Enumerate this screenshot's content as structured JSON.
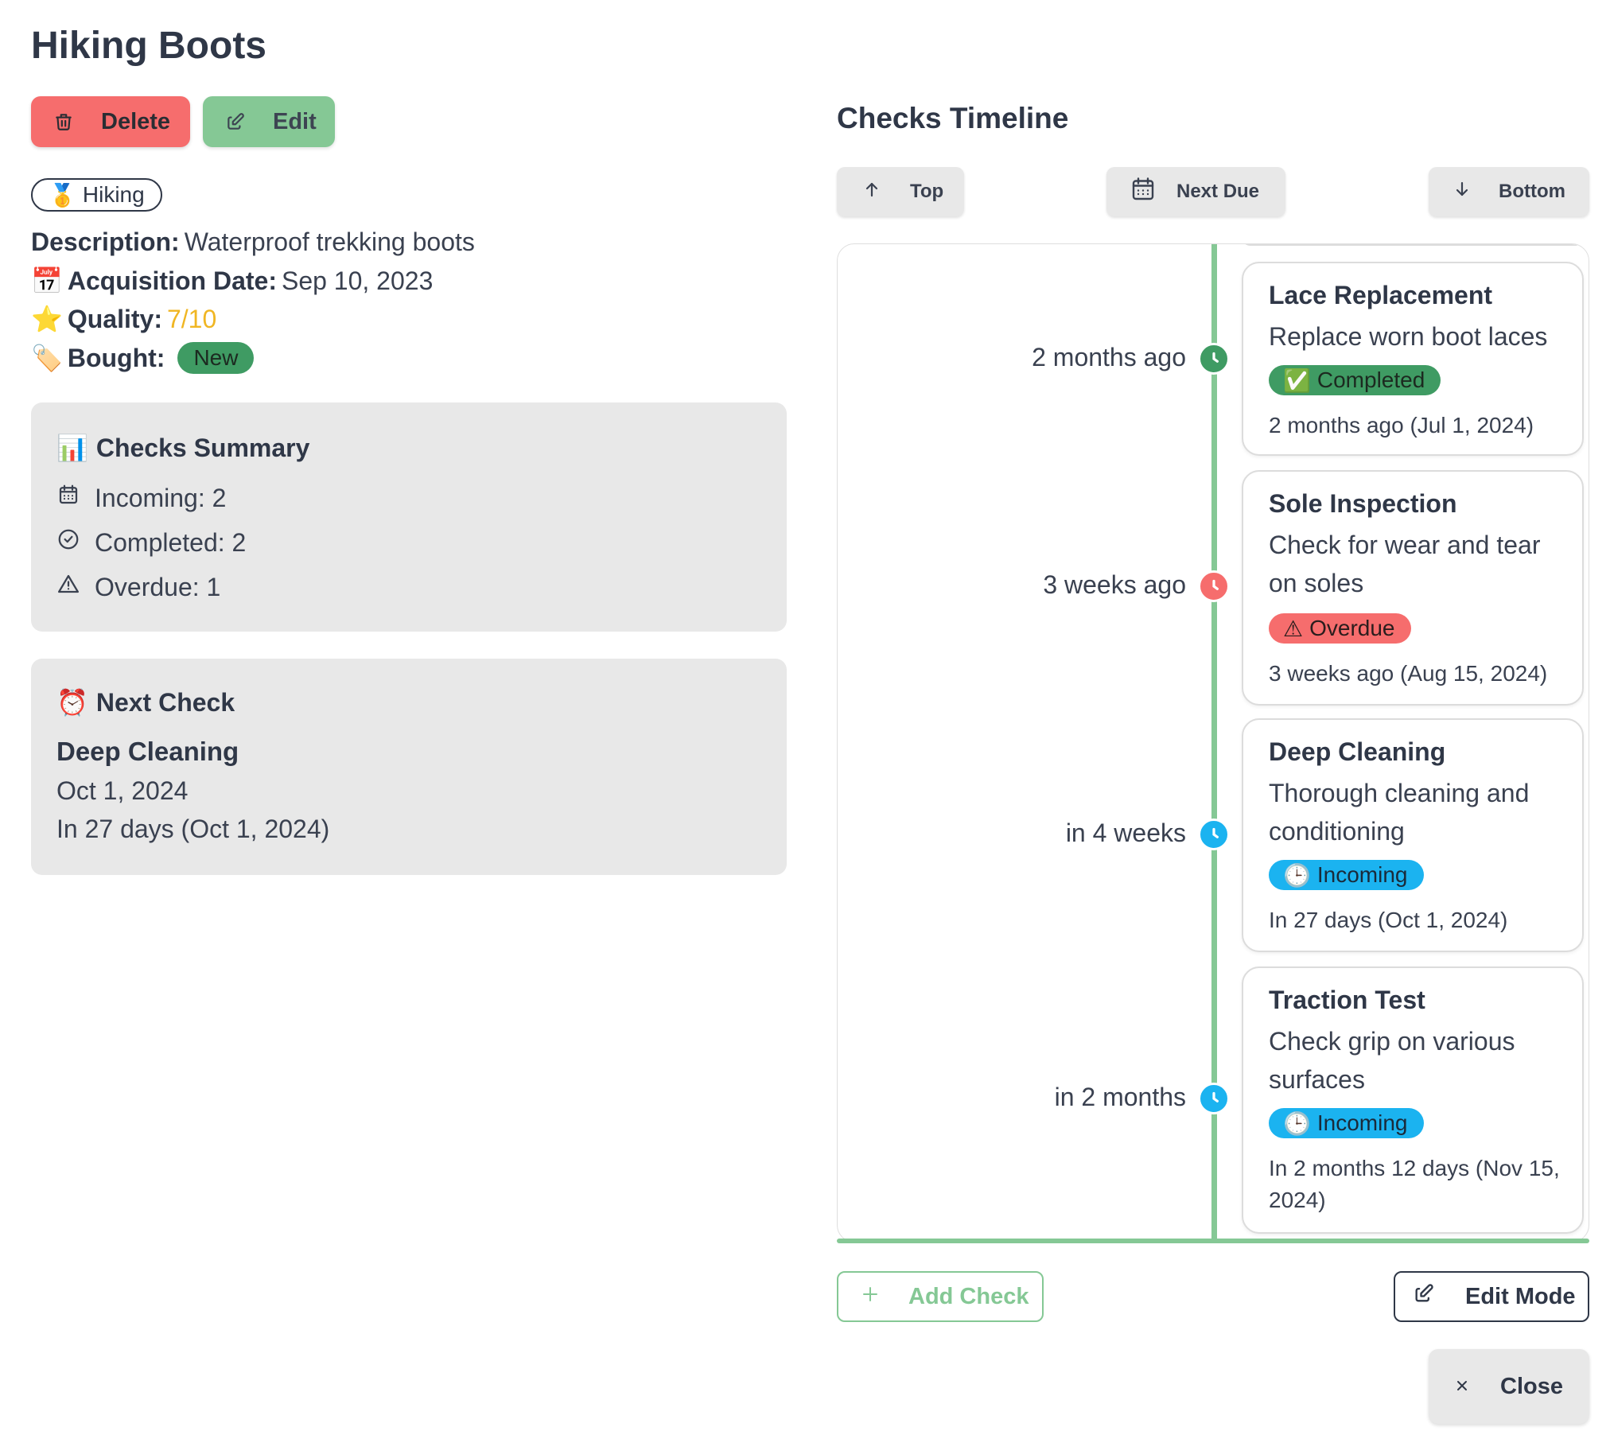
{
  "header": {
    "title": "Hiking Boots"
  },
  "actions": {
    "delete_label": "Delete",
    "edit_label": "Edit"
  },
  "category_tag": {
    "emoji": "🥇",
    "label": "Hiking"
  },
  "details": {
    "description_label": "Description:",
    "description_value": "Waterproof trekking boots",
    "acquisition_emoji": "📅",
    "acquisition_label": "Acquisition Date:",
    "acquisition_value": "Sep 10, 2023",
    "quality_emoji": "⭐",
    "quality_label": "Quality:",
    "quality_value": "7/10",
    "bought_emoji": "🏷️",
    "bought_label": "Bought:",
    "bought_value": "New"
  },
  "summary": {
    "emoji": "📊",
    "title": "Checks Summary",
    "incoming": "Incoming: 2",
    "completed": "Completed: 2",
    "overdue": "Overdue: 1"
  },
  "next_check": {
    "emoji": "⏰",
    "title": "Next Check",
    "name": "Deep Cleaning",
    "date": "Oct 1, 2024",
    "relative": "In 27 days (Oct 1, 2024)"
  },
  "timeline": {
    "title": "Checks Timeline",
    "nav": {
      "top": "Top",
      "next_due": "Next Due",
      "bottom": "Bottom"
    },
    "items": [
      {
        "when": "2 months ago",
        "title": "Lace Replacement",
        "description": "Replace worn boot laces",
        "status_emoji": "✅",
        "status": "Completed",
        "status_color": "#3f9b63",
        "date_text": "2 months ago (Jul 1, 2024)"
      },
      {
        "when": "3 weeks ago",
        "title": "Sole Inspection",
        "description": "Check for wear and tear on soles",
        "status_emoji": "⚠",
        "status": "Overdue",
        "status_color": "#f66d6d",
        "date_text": "3 weeks ago (Aug 15, 2024)"
      },
      {
        "when": "in 4 weeks",
        "title": "Deep Cleaning",
        "description": "Thorough cleaning and conditioning",
        "status_emoji": "🕒",
        "status": "Incoming",
        "status_color": "#1bb3f0",
        "date_text": "In 27 days (Oct 1, 2024)"
      },
      {
        "when": "in 2 months",
        "title": "Traction Test",
        "description": "Check grip on various surfaces",
        "status_emoji": "🕒",
        "status": "Incoming",
        "status_color": "#1bb3f0",
        "date_text": "In 2 months 12 days (Nov 15, 2024)"
      }
    ]
  },
  "footer": {
    "add_check": "Add Check",
    "edit_mode": "Edit Mode",
    "close": "Close"
  },
  "colors": {
    "accent_green": "#85c895",
    "danger": "#f66d6d",
    "info": "#1bb3f0",
    "success": "#3f9b63",
    "star": "#f0b623"
  }
}
